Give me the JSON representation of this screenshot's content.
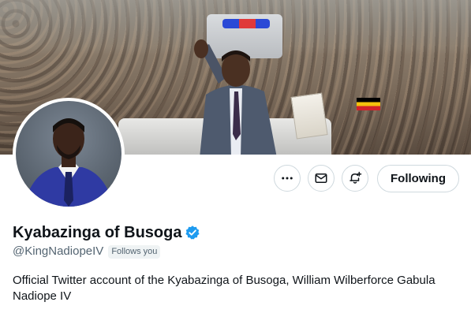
{
  "profile": {
    "display_name": "Kyabazinga of Busoga",
    "handle": "@KingNadiopeIV",
    "follows_you_label": "Follows you",
    "bio": "Official Twitter account of the Kyabazinga of Busoga, William Wilberforce Gabula Nadiope IV",
    "verified": true
  },
  "actions": {
    "more_icon": "more-horizontal-icon",
    "message_icon": "envelope-icon",
    "notify_icon": "bell-plus-icon",
    "follow_label": "Following"
  },
  "colors": {
    "verified_blue": "#1d9bf0",
    "text_primary": "#0f1419",
    "text_secondary": "#536471",
    "border": "#cfd9de"
  }
}
